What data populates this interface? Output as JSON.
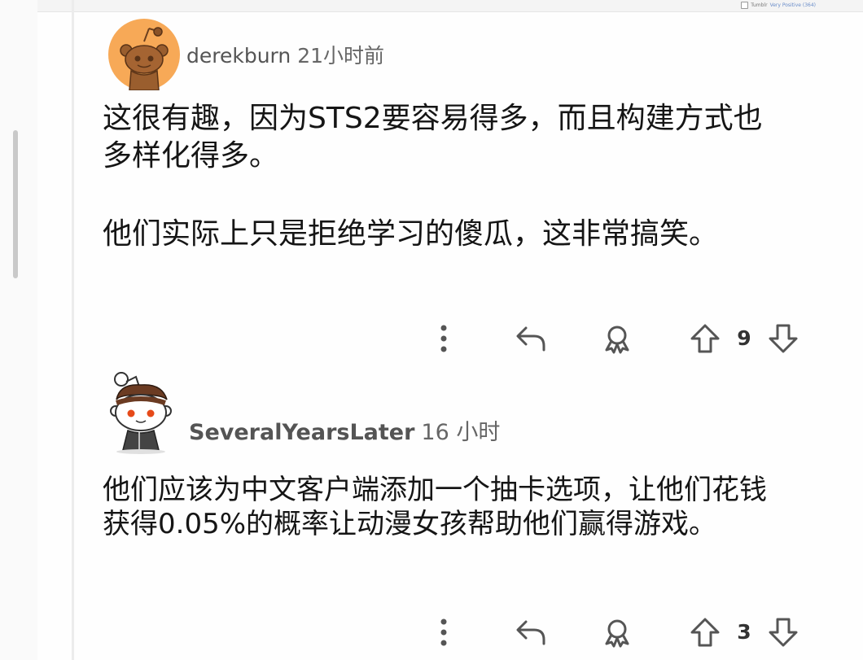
{
  "top_strip": {
    "label": "Tumblr",
    "link_text": "Very Positive (364)"
  },
  "comments": [
    {
      "author": "derekburn",
      "timestamp": "21小时前",
      "body_lines": [
        "这很有趣，因为STS2要容易得多，而且构建方式也",
        "多样化得多。",
        "他们实际上只是拒绝学习的傻瓜，这非常搞笑。"
      ],
      "votes": "9"
    },
    {
      "author": "SeveralYearsLater",
      "timestamp": "16 小时",
      "body_lines": [
        "他们应该为中文客户端添加一个抽卡选项，让他们花钱",
        "获得0.05%的概率让动漫女孩帮助他们赢得游戏。"
      ],
      "votes": "3"
    }
  ],
  "icons": {
    "more": "more-vertical-icon",
    "reply": "reply-icon",
    "award": "award-icon",
    "upvote": "upvote-arrow-icon",
    "downvote": "downvote-arrow-icon"
  },
  "colors": {
    "avatar_orange": "#F7A957",
    "icon_gray": "#555555",
    "text": "#151515",
    "meta": "#555555"
  }
}
